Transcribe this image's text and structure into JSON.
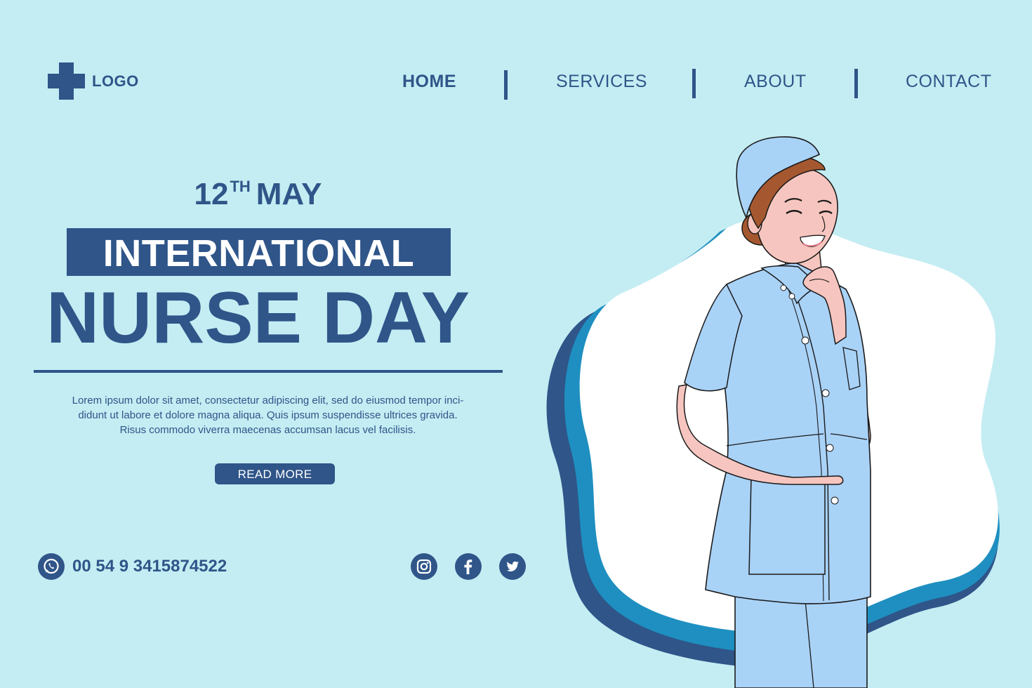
{
  "header": {
    "logo_text": "LOGO",
    "nav": [
      {
        "label": "HOME",
        "active": true
      },
      {
        "label": "SERVICES",
        "active": false
      },
      {
        "label": "ABOUT",
        "active": false
      },
      {
        "label": "CONTACT",
        "active": false
      }
    ]
  },
  "hero": {
    "date_day": "12",
    "date_suffix": "TH",
    "date_month": "MAY",
    "title_line1": "INTERNATIONAL",
    "title_line2": "NURSE DAY",
    "body_line1": "Lorem ipsum dolor sit amet, consectetur adipiscing elit, sed do eiusmod tempor inci-",
    "body_line2": "didunt ut labore et dolore magna aliqua. Quis ipsum suspendisse ultrices gravida.",
    "body_line3": "Risus commodo viverra maecenas accumsan lacus vel facilisis.",
    "cta_label": "READ MORE"
  },
  "contact": {
    "phone_icon": "whatsapp-icon",
    "phone": "00 54 9 3415874522",
    "social_icons": [
      "instagram-icon",
      "facebook-icon",
      "twitter-icon"
    ]
  },
  "colors": {
    "background": "#c4edf3",
    "primary": "#2f5589",
    "uniform": "#a9d2f7",
    "blob_accent": "#1e8fc0"
  }
}
